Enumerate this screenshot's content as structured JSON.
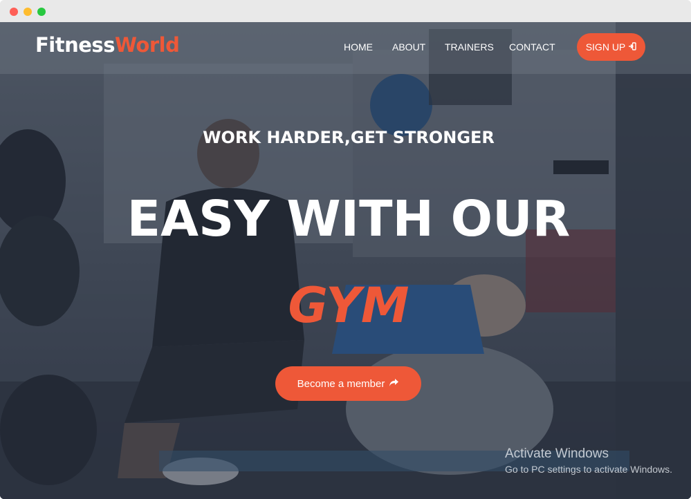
{
  "brand": {
    "part1": "Fitness",
    "part2": "World",
    "accent_color": "#ee5838"
  },
  "nav": {
    "items": [
      {
        "label": "HOME"
      },
      {
        "label": "ABOUT"
      },
      {
        "label": "TRAINERS"
      },
      {
        "label": "CONTACT"
      }
    ],
    "signup_label": "SIGN UP",
    "signup_icon": "sign-in-icon"
  },
  "hero": {
    "subtitle": "WORK HARDER,GET STRONGER",
    "title": "EASY WITH OUR",
    "highlight": "GYM",
    "cta_label": "Become a member",
    "cta_icon": "share-arrow-icon"
  },
  "watermark": {
    "title": "Activate Windows",
    "desc": "Go to PC settings to activate Windows."
  },
  "window": {
    "controls": [
      "close",
      "minimize",
      "maximize"
    ]
  }
}
